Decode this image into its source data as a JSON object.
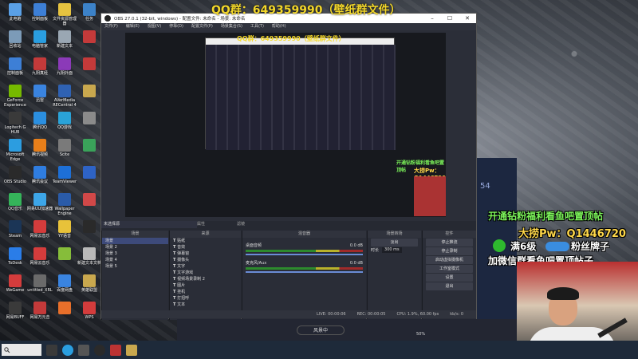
{
  "banner": {
    "text": "QQ群：649359990（壁纸群文件）"
  },
  "desktop": {
    "icons": [
      {
        "label": "此电脑",
        "color": "#5aa0e6"
      },
      {
        "label": "控制面板",
        "color": "#3d7fd6"
      },
      {
        "label": "文件资源管理器",
        "color": "#e6c340"
      },
      {
        "label": "任务",
        "color": "#3c82c8"
      },
      {
        "label": "回收站",
        "color": "#7c9bb8"
      },
      {
        "label": "电脑管家",
        "color": "#2a9ee0"
      },
      {
        "label": "新建文本",
        "color": "#9aa7b3"
      },
      {
        "label": "",
        "color": "#c43a3a"
      },
      {
        "label": "控制面板",
        "color": "#3d7fd6"
      },
      {
        "label": "九阴真经",
        "color": "#c43a3a"
      },
      {
        "label": "九阴外面",
        "color": "#8b3ab8"
      },
      {
        "label": "",
        "color": "#c43a3a"
      },
      {
        "label": "GeForce Experience",
        "color": "#76b900"
      },
      {
        "label": "迅雷",
        "color": "#3a84e0"
      },
      {
        "label": "AVerMedia RECentral 4",
        "color": "#2f62b3"
      },
      {
        "label": "",
        "color": "#c9a84e"
      },
      {
        "label": "Logitech G HUB",
        "color": "#3a3a3a"
      },
      {
        "label": "腾讯QQ",
        "color": "#2b8fe0"
      },
      {
        "label": "QQ游戏",
        "color": "#2aa3d8"
      },
      {
        "label": "",
        "color": "#8b8b8b"
      },
      {
        "label": "Microsoft Edge",
        "color": "#2c9de0"
      },
      {
        "label": "腾讯视频",
        "color": "#e87f1a"
      },
      {
        "label": "Scite",
        "color": "#7a7a7a"
      },
      {
        "label": "",
        "color": "#3aa35a"
      },
      {
        "label": "OBS Studio",
        "color": "#2a2a2a"
      },
      {
        "label": "腾讯会议",
        "color": "#2f7de0"
      },
      {
        "label": "TeamViewer",
        "color": "#1d6fd6"
      },
      {
        "label": "",
        "color": "#2e63c6"
      },
      {
        "label": "QQ音乐",
        "color": "#35b45a"
      },
      {
        "label": "网易UU加速器",
        "color": "#3da6e8"
      },
      {
        "label": "Wallpaper Engine",
        "color": "#2a5ba8"
      },
      {
        "label": "",
        "color": "#d14848"
      },
      {
        "label": "Steam",
        "color": "#1b3556"
      },
      {
        "label": "网易云音乐",
        "color": "#d43c3c"
      },
      {
        "label": "YY语音",
        "color": "#e8c23a"
      },
      {
        "label": "",
        "color": "#2a2a2a"
      },
      {
        "label": "ToDesk",
        "color": "#2a7de8"
      },
      {
        "label": "网易云音乐",
        "color": "#d43c3c"
      },
      {
        "label": "",
        "color": "#86bd3a"
      },
      {
        "label": "新建文本文档",
        "color": "#b9b9b9"
      },
      {
        "label": "WeGame",
        "color": "#d43c3c"
      },
      {
        "label": "untitled_XRL",
        "color": "#6a6a6a"
      },
      {
        "label": "百度网盘",
        "color": "#3a84e0"
      },
      {
        "label": "英雄联盟",
        "color": "#c9a84e"
      },
      {
        "label": "网易BUFF",
        "color": "#3a3a3a"
      },
      {
        "label": "网易万元击",
        "color": "#c43a3a"
      },
      {
        "label": "",
        "color": "#e86f2a"
      },
      {
        "label": "WPS",
        "color": "#d43c3c"
      }
    ]
  },
  "obs": {
    "title": "OBS 27.0.1 (32-bit, windows) - 配置文件: 未命名 - 场景: 未命名",
    "menu": [
      "文件(F)",
      "编辑(E)",
      "视图(V)",
      "停靠(D)",
      "配置文件(P)",
      "场景集合(S)",
      "工具(T)",
      "帮助(H)"
    ],
    "preview_banner": "QQ群：649359990（壁纸群文件）",
    "no_source": "未选择源",
    "props_label": "属性",
    "filter_label": "滤镜",
    "scenes": {
      "header": "场景",
      "items": [
        "场景",
        "场景 2",
        "场景 3",
        "场景 4",
        "场景 5"
      ]
    },
    "sources": {
      "header": "来源",
      "items": [
        "贴纸",
        "音效",
        "弹幕窗",
        "摄像头",
        "文字",
        "文字游戏",
        "视频场景录制 2",
        "图片",
        "挂机",
        "打招呼",
        "文本"
      ]
    },
    "mixer": {
      "header": "混音器",
      "tracks": [
        {
          "name": "桌面音频",
          "level": "0.0 dB"
        },
        {
          "name": "麦克风/Aux",
          "level": "0.0 dB"
        }
      ]
    },
    "transitions": {
      "header": "场景转场",
      "type": "淡出",
      "duration_label": "时长",
      "duration": "300 ms"
    },
    "controls": {
      "header": "控件",
      "buttons": [
        "停止推流",
        "停止录制",
        "启动虚拟摄像机",
        "工作室模式",
        "设置",
        "退出"
      ]
    },
    "status": {
      "live": "LIVE: 00:00:06",
      "rec": "REC: 00:00:05",
      "cpu": "CPU: 1.9%, 60.00 fps",
      "kbps": "kb/s: 0"
    }
  },
  "overlay": {
    "promo1": "开通钻粉福利看鱼吧置顶帖",
    "promo2": "大捞Pw：Q1446720",
    "promo3": "满6级",
    "promo3b": "粉丝牌子",
    "promo4": "加微信群看鱼吧置顶帖子",
    "bg_number": "54",
    "lower_label": "风景中",
    "lower_pct": "50%"
  },
  "taskbar": {
    "search_placeholder": "",
    "clock": ""
  }
}
